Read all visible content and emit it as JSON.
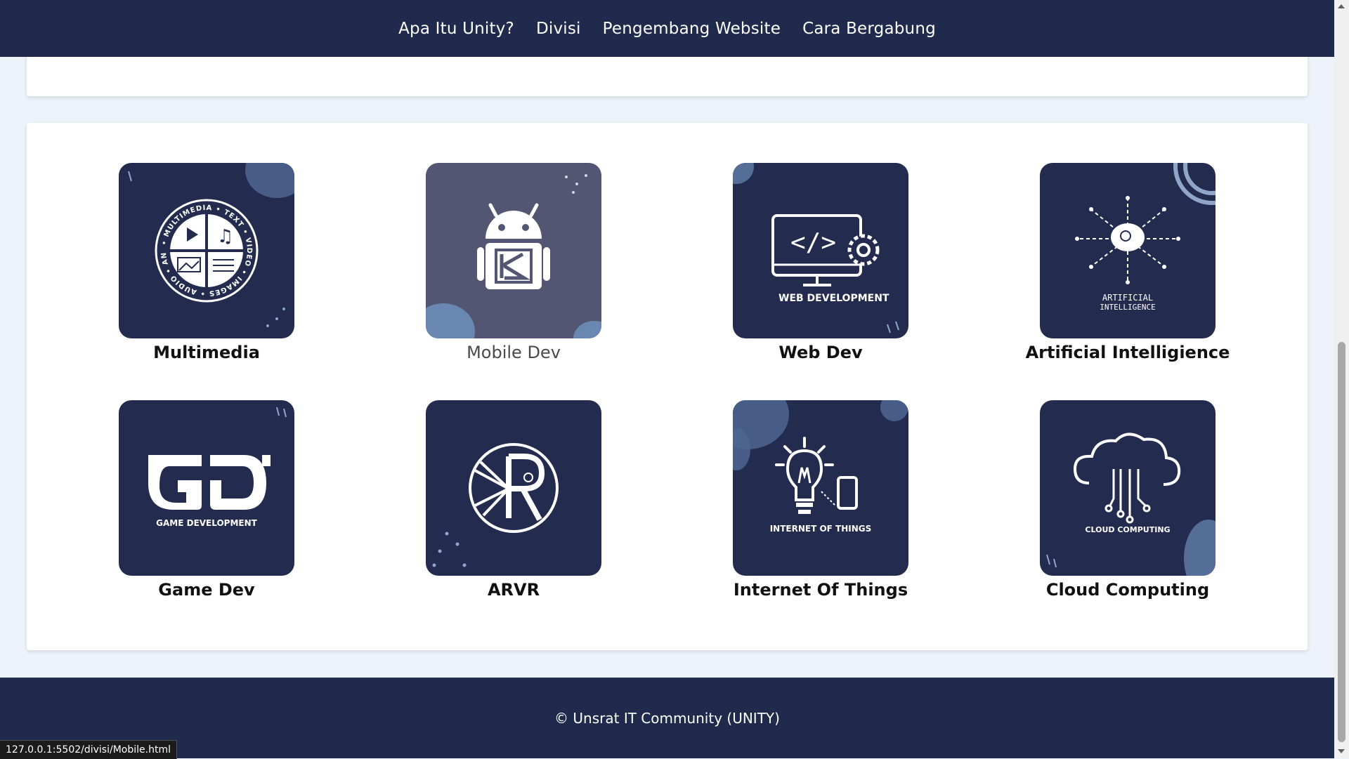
{
  "nav": {
    "links": [
      "Apa Itu Unity?",
      "Divisi",
      "Pengembang Website",
      "Cara Bergabung"
    ]
  },
  "divisions": [
    {
      "label": "Multimedia",
      "icon": "multimedia-logo-icon",
      "icon_text": [
        "MULTIMEDIA",
        "TEXT",
        "VIDEO",
        "IMAGES",
        "AUDIO",
        "ANIMATION"
      ]
    },
    {
      "label": "Mobile Dev",
      "icon": "android-logo-icon",
      "hover": true
    },
    {
      "label": "Web Dev",
      "icon": "web-development-logo-icon",
      "icon_text": [
        "WEB DEVELOPMENT"
      ]
    },
    {
      "label": "Artificial Intelligience",
      "icon": "artificial-intelligence-logo-icon",
      "icon_text": [
        "ARTIFICIAL",
        "INTELLIGENCE"
      ]
    },
    {
      "label": "Game Dev",
      "icon": "game-development-logo-icon",
      "icon_text": [
        "GAME DEVELOPMENT"
      ]
    },
    {
      "label": "ARVR",
      "icon": "arvr-logo-icon"
    },
    {
      "label": "Internet Of Things",
      "icon": "internet-of-things-logo-icon",
      "icon_text": [
        "INTERNET OF THINGS"
      ]
    },
    {
      "label": "Cloud Computing",
      "icon": "cloud-computing-logo-icon",
      "icon_text": [
        "CLOUD COMPUTING"
      ]
    }
  ],
  "footer": {
    "copyright": "© Unsrat IT Community (UNITY)"
  },
  "status_bar": {
    "url": "127.0.0.1:5502/divisi/Mobile.html"
  },
  "colors": {
    "navy": "#1f2a4d",
    "tile_bg": "#232b4f",
    "tile_hover_bg": "#535672",
    "page_bg": "#edf2fb",
    "accent_blob": "#5d7aa5"
  }
}
